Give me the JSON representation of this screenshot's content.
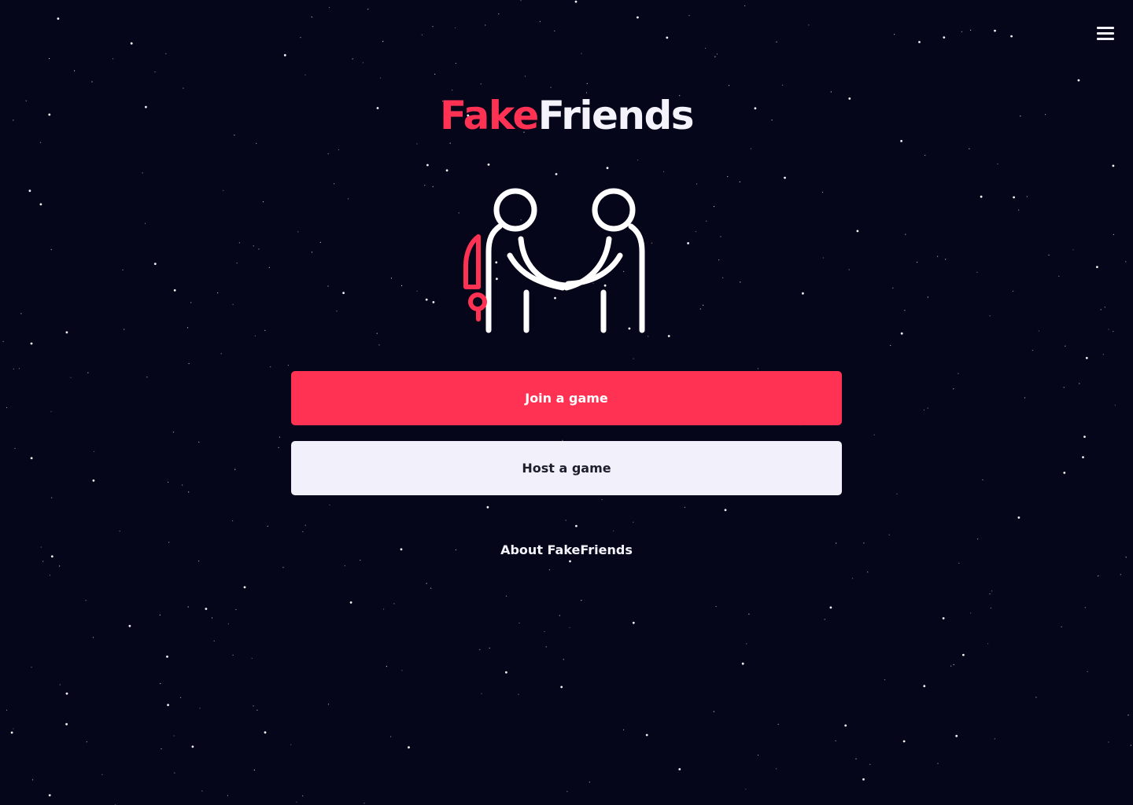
{
  "app": {
    "logo_part_1": "Fake",
    "logo_part_2": "Friends",
    "accent_color": "#ff3254",
    "light_color": "#f4f3fb",
    "background_color": "#06061b"
  },
  "header": {
    "menu_icon": "hamburger-menu-icon"
  },
  "illustration": {
    "icon": "handshake-with-hidden-knife-icon"
  },
  "actions": {
    "join_label": "Join a game",
    "host_label": "Host a game",
    "about_label": "About FakeFriends"
  }
}
